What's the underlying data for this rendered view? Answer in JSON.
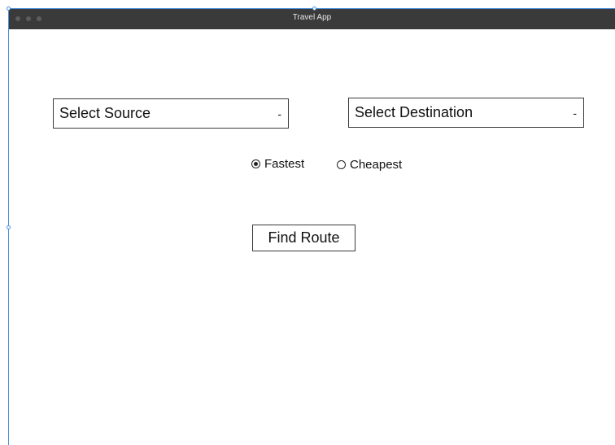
{
  "window": {
    "title": "Travel App"
  },
  "form": {
    "source_select": {
      "label": "Select Source",
      "caret": "-"
    },
    "destination_select": {
      "label": "Select Destination",
      "caret": "-"
    },
    "route_preference": {
      "options": [
        {
          "label": "Fastest",
          "selected": true
        },
        {
          "label": "Cheapest",
          "selected": false
        }
      ]
    },
    "find_route_label": "Find Route"
  },
  "colors": {
    "titlebar": "#3a3a3a",
    "selection": "#4a90d9"
  }
}
